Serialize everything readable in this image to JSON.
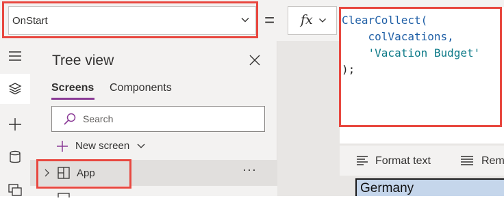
{
  "formula_bar": {
    "property": "OnStart",
    "equals": "=",
    "fx_label": "fx",
    "code": {
      "line1_fn": "ClearCollect(",
      "line2_arg": "    colVacations,",
      "line3_arg": "    'Vacation Budget'",
      "line4": ");"
    }
  },
  "rail": {
    "icons": [
      "hamburger-icon",
      "layers-icon",
      "plus-icon",
      "database-icon",
      "media-icon"
    ]
  },
  "tree_view": {
    "title": "Tree view",
    "tabs": [
      "Screens",
      "Components"
    ],
    "active_tab": "Screens",
    "search_placeholder": "Search",
    "new_screen_label": "New screen",
    "items": [
      {
        "label": "App",
        "more": "···"
      }
    ]
  },
  "canvas": {
    "format_text_label": "Format text",
    "remove_label": "Rem",
    "cell_value": "Germany"
  },
  "colors": {
    "accent": "#8a3a96",
    "highlight": "#e8473f",
    "code_blue": "#1f5fa6",
    "code_string": "#0d7a88"
  }
}
